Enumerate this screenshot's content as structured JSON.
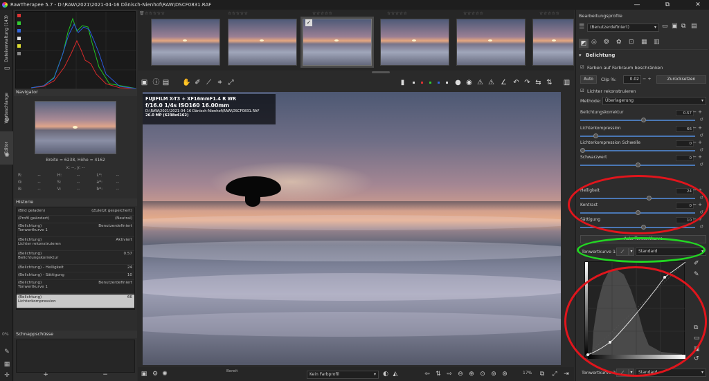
{
  "window": {
    "title": "RawTherapee 5.7 - D:\\RAW\\2021\\2021-04-16 Dänisch-Nienhof\\RAW\\DSCF0831.RAF",
    "minimize": "—",
    "maximize": "⧉",
    "close": "✕"
  },
  "left_tabs": {
    "file_browser": "Dateiverwaltung (143)",
    "queue": "Warteschlange",
    "editor": "Editor"
  },
  "navigator": {
    "header": "Navigator",
    "dimensions": "Breite = 6238, Höhe = 4162",
    "cursor": "x: --, y: --",
    "readout": [
      [
        "R:",
        "--",
        "H:",
        "--",
        "L*:",
        "--"
      ],
      [
        "G:",
        "--",
        "S:",
        "--",
        "a*:",
        "--"
      ],
      [
        "B:",
        "--",
        "V:",
        "--",
        "b*:",
        "--"
      ]
    ]
  },
  "history": {
    "header": "Historie",
    "items": [
      {
        "name": "(Bild geladen)",
        "value": "(Zuletzt gespeichert)"
      },
      {
        "name": "(Profil geändert)",
        "value": "(Neutral)"
      },
      {
        "name": "(Belichtung)",
        "sub": "Tonwertkurve 1",
        "value": "Benutzerdefiniert"
      },
      {
        "name": "(Belichtung)",
        "sub": "Lichter rekonstruieren",
        "value": "Aktiviert"
      },
      {
        "name": "(Belichtung)",
        "sub": "Belichtungskorrektur",
        "value": "0.57"
      },
      {
        "name": "(Belichtung) - Helligkeit",
        "value": "24"
      },
      {
        "name": "(Belichtung) - Sättigung",
        "value": "10"
      },
      {
        "name": "(Belichtung)",
        "sub": "Tonwertkurve 1",
        "value": "Benutzerdefiniert"
      },
      {
        "name": "(Belichtung)",
        "sub": "Lichterkompression",
        "value": "66",
        "selected": true
      }
    ]
  },
  "snapshots": {
    "header": "Schnappschüsse",
    "add": "+",
    "remove": "−"
  },
  "zoom_left": "0%",
  "filmstrip": {
    "stars": "☆☆☆☆☆"
  },
  "overlay": {
    "camera": "FUJIFILM X-T3 + XF16mmF1.4 R WR",
    "exposure": "f/16.0  1/4s  ISO160  16.00mm",
    "path": "D:\\RAW\\2021\\2021-04-16 Dänisch-Nienhof\\RAW\\DSCF0831.RAF",
    "size": "26.0 MP (6238x4162)"
  },
  "bottombar": {
    "status": "Bereit",
    "profile": "Kein Farbprofil",
    "zoom": "17%"
  },
  "right": {
    "header": "Bearbeitungsprofile",
    "profile": "(Benutzerdefiniert)",
    "section": "Belichtung",
    "clip_colors": "Farben auf Farbraum beschränken",
    "auto": "Auto",
    "clip_label": "Clip %:",
    "clip_value": "0.02",
    "reset": "Zurücksetzen",
    "highlight_recon": "Lichter rekonstruieren",
    "method_label": "Methode:",
    "method_value": "Überlagerung",
    "controls": [
      {
        "name": "Belichtungskorrektur",
        "value": "0.57",
        "pos": 0.55
      },
      {
        "name": "Lichterkompression",
        "value": "66",
        "pos": 0.12
      },
      {
        "name": "Lichterkompression Schwelle",
        "value": "0",
        "pos": 0.0
      },
      {
        "name": "Schwarzwert",
        "value": "0",
        "pos": 0.5
      },
      {
        "name": "Helligkeit",
        "value": "24",
        "pos": 0.6
      },
      {
        "name": "Kontrast",
        "value": "0",
        "pos": 0.5
      },
      {
        "name": "Sättigung",
        "value": "10",
        "pos": 0.55
      }
    ],
    "auto_tone": "Auto-Tonwertkurve",
    "tone_curve_1": "Tonwertkurve 1:",
    "tone_curve_1_type": "Standard",
    "tone_curve_2": "Tonwertkurve 2:",
    "tone_curve_2_type": "Standard"
  },
  "colors": {
    "accent": "#4a77b4",
    "highlight_red": "#e0151c",
    "highlight_green": "#22d622"
  }
}
